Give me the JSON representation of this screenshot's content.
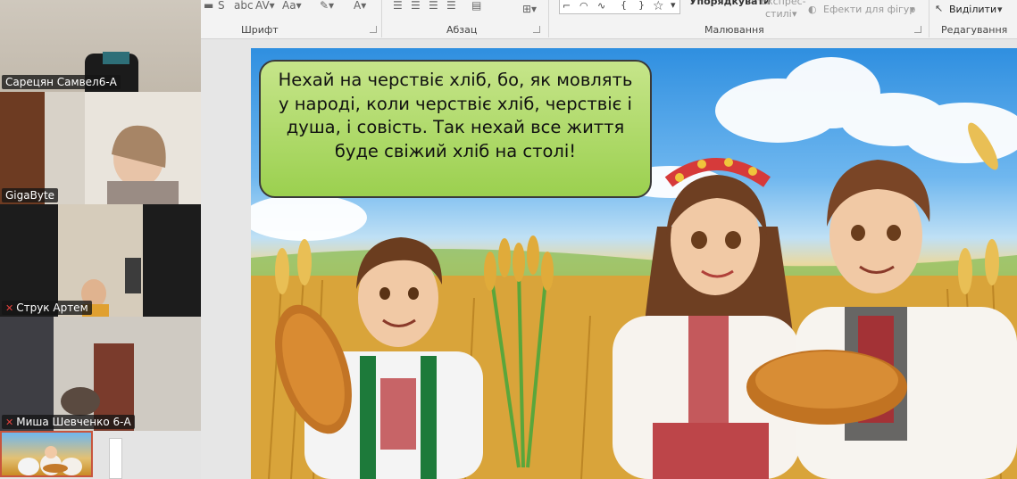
{
  "ribbon": {
    "font_group_label": "Шрифт",
    "paragraph_group_label": "Абзац",
    "drawing_group_label": "Малювання",
    "editing_group_label": "Редагування",
    "arrange_label": "Упорядкувати",
    "quick_styles_line1": "Експрес-",
    "quick_styles_line2": "стилі",
    "shape_effects_label": "Ефекти для фігур",
    "select_label": "Виділити",
    "font_icons": [
      "strikethrough-icon",
      "character-spacing-icon",
      "change-case-icon",
      "highlight-icon",
      "font-color-icon"
    ],
    "font_icon_glyphs": [
      "abc",
      "AV",
      "Aa",
      "✎",
      "A"
    ],
    "shape_glyphs": [
      "⌐",
      "◠",
      "∿",
      "{",
      "}",
      "☆"
    ]
  },
  "participants": [
    {
      "name": "Сарецян Самвел6-А",
      "muted": false
    },
    {
      "name": "GigaByte",
      "muted": false
    },
    {
      "name": "Струк Артем",
      "muted": true
    },
    {
      "name": "Миша Шевченко 6-А",
      "muted": true
    }
  ],
  "slide": {
    "speech_text": "Нехай на черствіє хліб, бо, як мовлять у народі, коли черствіє хліб, черствіє і душа, і совість. Так нехай все життя буде свіжий хліб на столі!"
  },
  "colors": {
    "thumbnail_border": "#c8553d",
    "speech_bubble": "#9bd04f"
  }
}
